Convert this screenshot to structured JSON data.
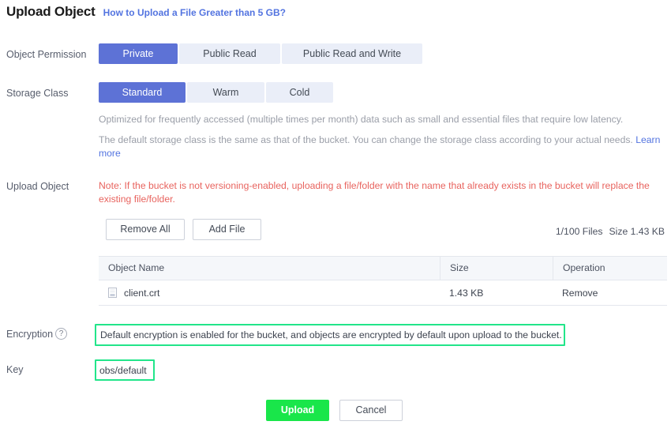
{
  "header": {
    "title": "Upload Object",
    "link": "How to Upload a File Greater than 5 GB?"
  },
  "object_permission": {
    "label": "Object Permission",
    "options": [
      {
        "label": "Private",
        "selected": true
      },
      {
        "label": "Public Read",
        "selected": false
      },
      {
        "label": "Public Read and Write",
        "selected": false
      }
    ]
  },
  "storage_class": {
    "label": "Storage Class",
    "options": [
      {
        "label": "Standard",
        "selected": true
      },
      {
        "label": "Warm",
        "selected": false
      },
      {
        "label": "Cold",
        "selected": false
      }
    ],
    "desc1": "Optimized for frequently accessed (multiple times per month) data such as small and essential files that require low latency.",
    "desc2_before": "The default storage class is the same as that of the bucket. You can change the storage class according to your actual needs. ",
    "desc2_link": "Learn more"
  },
  "upload_object": {
    "label": "Upload Object",
    "note": "Note: If the bucket is not versioning-enabled, uploading a file/folder with the name that already exists in the bucket will replace the existing file/folder.",
    "remove_all_button": "Remove All",
    "add_file_button": "Add File",
    "file_count": "1/100 Files",
    "size_label": "Size",
    "size_value": "1.43 KB",
    "table": {
      "columns": [
        "Object Name",
        "Size",
        "Operation"
      ],
      "rows": [
        {
          "icon": "file-icon",
          "name": "client.crt",
          "size": "1.43 KB",
          "operation": "Remove"
        }
      ]
    }
  },
  "encryption": {
    "label": "Encryption",
    "help_icon": "question-mark-icon",
    "value": "Default encryption is enabled for the bucket, and objects are encrypted by default upon upload to the bucket."
  },
  "key": {
    "label": "Key",
    "value": "obs/default"
  },
  "footer": {
    "upload_button": "Upload",
    "cancel_button": "Cancel"
  },
  "colors": {
    "accent_blue": "#5d72d6",
    "link_blue": "#5374e0",
    "note_red": "#e8635e",
    "highlight_green": "#22e58a",
    "upload_green": "#19e64a"
  }
}
